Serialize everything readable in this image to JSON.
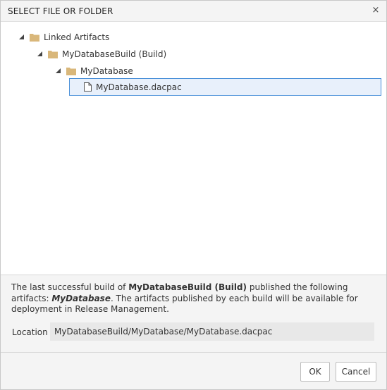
{
  "dialog": {
    "title": "SELECT FILE OR FOLDER",
    "close_glyph": "×"
  },
  "tree": {
    "nodes": [
      {
        "label": "Linked Artifacts",
        "type": "folder",
        "expanded": true,
        "icon": "folder-icon"
      },
      {
        "label": "MyDatabaseBuild (Build)",
        "type": "folder",
        "expanded": true,
        "icon": "folder-icon"
      },
      {
        "label": "MyDatabase",
        "type": "folder",
        "expanded": true,
        "icon": "folder-icon"
      },
      {
        "label": "MyDatabase.dacpac",
        "type": "file",
        "selected": true,
        "icon": "file-icon"
      }
    ]
  },
  "info": {
    "text_prefix": "The last successful build of ",
    "build_name": "MyDatabaseBuild (Build)",
    "text_middle": " published the following artifacts: ",
    "artifact_name": "MyDatabase",
    "text_suffix": ". The artifacts published by each build will be available for deployment in Release Management.",
    "location_label": "Location",
    "location_value": "MyDatabaseBuild/MyDatabase/MyDatabase.dacpac"
  },
  "footer": {
    "ok_label": "OK",
    "cancel_label": "Cancel"
  },
  "colors": {
    "folder": "#d9b77a",
    "selection_border": "#4a90d9",
    "selection_fill": "#e8f0fb",
    "panel_bg": "#f4f4f4"
  }
}
